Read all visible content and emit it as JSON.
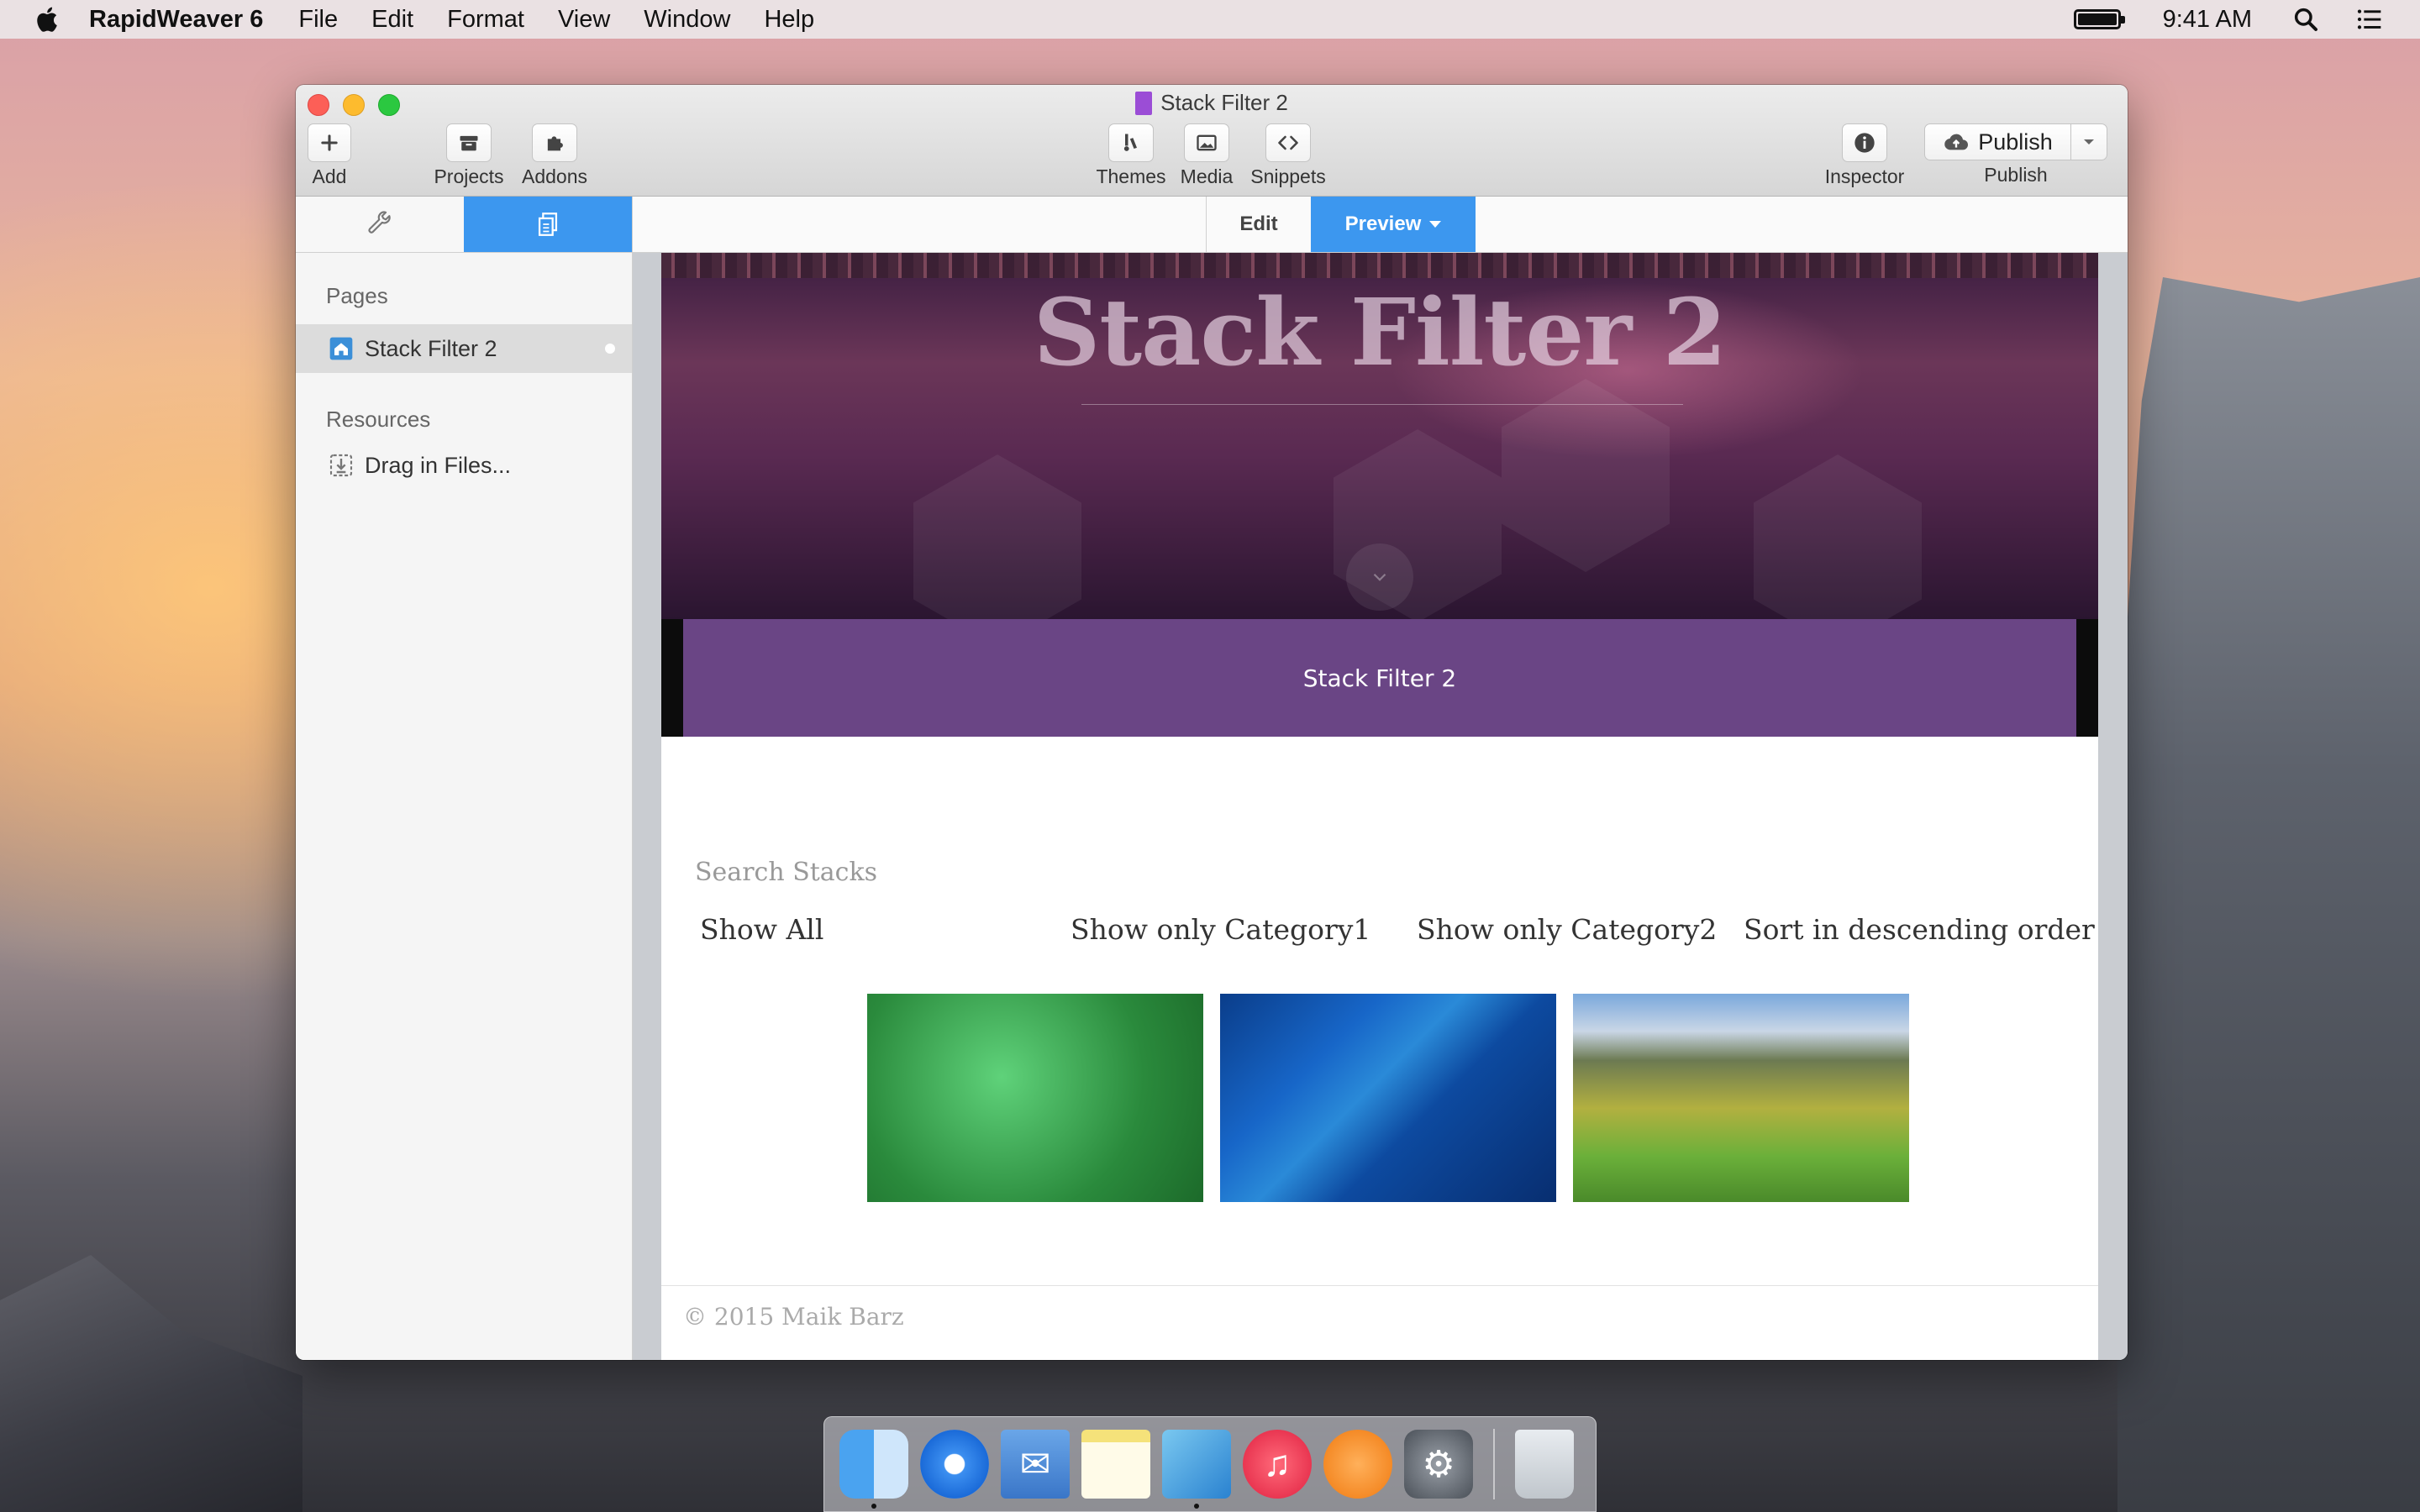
{
  "menubar": {
    "app_name": "RapidWeaver 6",
    "menus": [
      "File",
      "Edit",
      "Format",
      "View",
      "Window",
      "Help"
    ],
    "clock": "9:41 AM",
    "icons": [
      "apple-icon",
      "battery-icon",
      "spotlight-icon",
      "notification-center-icon"
    ]
  },
  "window": {
    "title": "Stack Filter 2",
    "toolbar": {
      "add": "Add",
      "projects": "Projects",
      "addons": "Addons",
      "themes": "Themes",
      "media": "Media",
      "snippets": "Snippets",
      "inspector": "Inspector",
      "publish_button": "Publish",
      "publish_label": "Publish"
    }
  },
  "sidebar": {
    "pages_heading": "Pages",
    "pages": [
      {
        "label": "Stack Filter 2",
        "selected": true
      }
    ],
    "resources_heading": "Resources",
    "resources": [
      {
        "label": "Drag in Files..."
      }
    ]
  },
  "main": {
    "edit_label": "Edit",
    "preview_label": "Preview"
  },
  "site": {
    "hero_title": "Stack Filter 2",
    "nav_title": "Stack Filter 2",
    "search_label": "Search Stacks",
    "filters": [
      "Show All",
      "Show only Category1",
      "Show only Category2",
      "Sort in descending order"
    ],
    "thumbnails": [
      "green-aerial-image",
      "blue-water-image",
      "mountain-valley-image"
    ],
    "footer": "© 2015 Maik Barz"
  },
  "dock": {
    "apps": [
      "Finder",
      "Safari",
      "Mail",
      "Notes",
      "Preview",
      "iTunes",
      "iBooks",
      "System Preferences",
      "Trash"
    ]
  },
  "colors": {
    "accent_blue": "#3c97ef",
    "nav_purple": "#6a4585"
  }
}
